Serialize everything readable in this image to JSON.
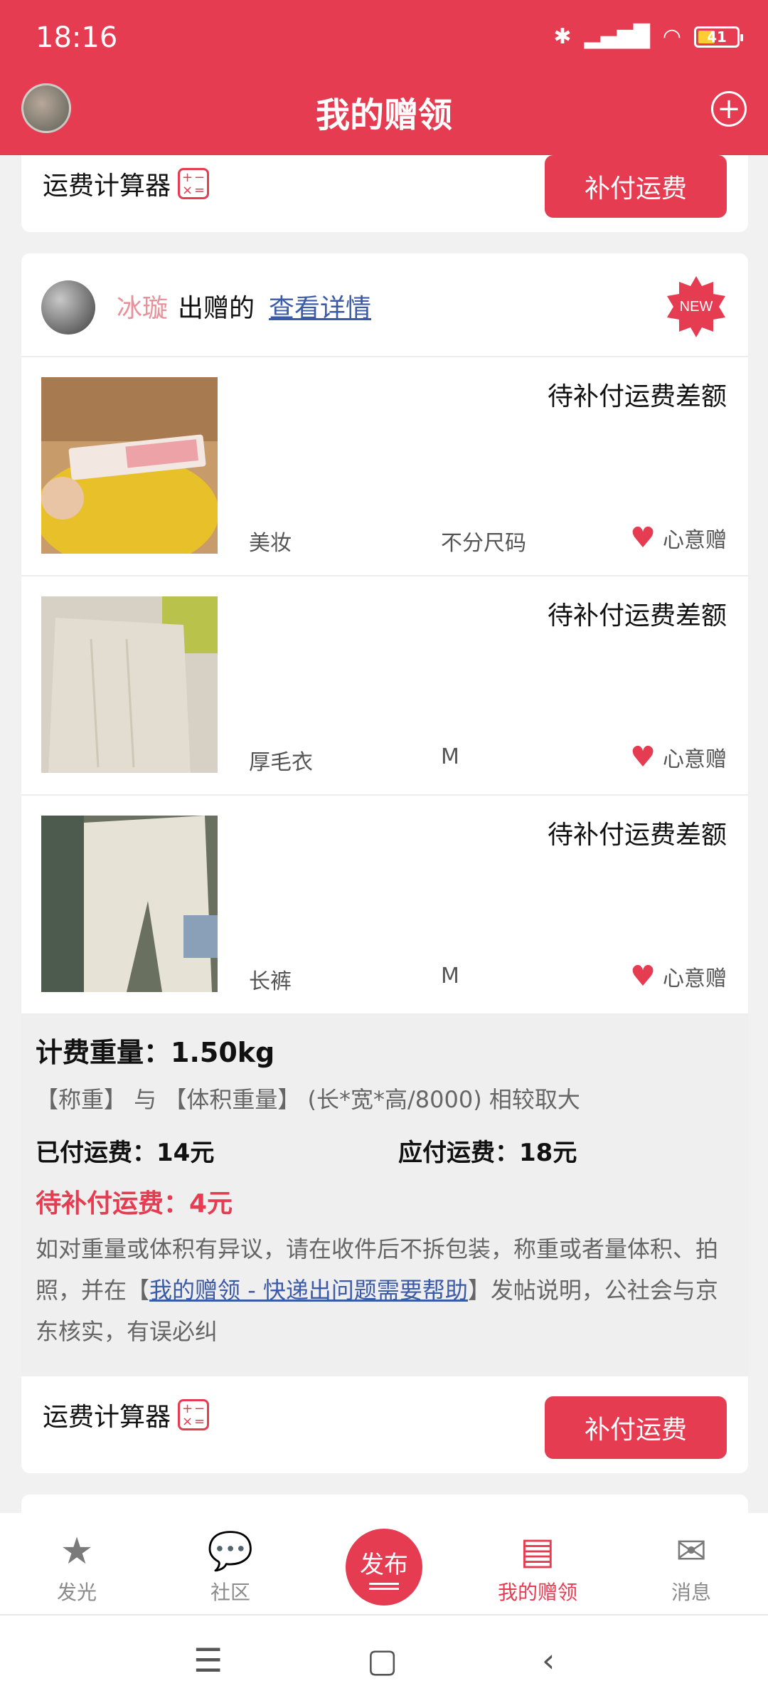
{
  "status_bar": {
    "time": "18:16",
    "battery": "41"
  },
  "header": {
    "title": "我的赠领"
  },
  "top_card": {
    "calculator_label": "运费计算器",
    "pay_button": "补付运费"
  },
  "donation_card": {
    "donor_name": "冰璇",
    "donor_suffix": "出赠的",
    "detail_link": "查看详情",
    "badge": "NEW",
    "items": [
      {
        "status": "待补付运费差额",
        "category": "美妆",
        "size": "不分尺码",
        "tag": "心意赠"
      },
      {
        "status": "待补付运费差额",
        "category": "厚毛衣",
        "size": "M",
        "tag": "心意赠"
      },
      {
        "status": "待补付运费差额",
        "category": "长裤",
        "size": "M",
        "tag": "心意赠"
      }
    ],
    "billing": {
      "weight": "计费重量：1.50kg",
      "rule": "【称重】 与 【体积重量】 (长*宽*高/8000) 相较取大",
      "paid": "已付运费：14元",
      "due": "应付运费：18元",
      "pending": "待补付运费：4元",
      "note_before": "如对重量或体积有异议，请在收件后不拆包装，称重或者量体积、拍照，并在【",
      "note_link": "我的赠领 - 快递出问题需要帮助",
      "note_after": "】发帖说明，公社会与京东核实，有误必纠"
    },
    "calculator_label": "运费计算器",
    "pay_button": "补付运费"
  },
  "bottom_nav": {
    "items": [
      {
        "label": "发光"
      },
      {
        "label": "社区"
      },
      {
        "label": "发布"
      },
      {
        "label": "我的赠领"
      },
      {
        "label": "消息"
      }
    ],
    "active": "我的赠领"
  },
  "colors": {
    "accent": "#e63c51",
    "link": "#3b5aa8"
  }
}
